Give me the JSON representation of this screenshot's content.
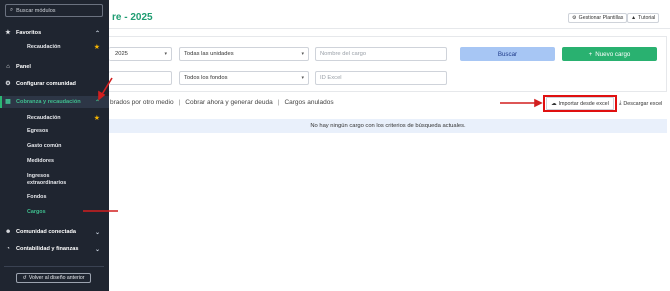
{
  "sidebar": {
    "search_placeholder": "Buscar módulos",
    "favoritos": "Favoritos",
    "fav_recaudacion": "Recaudación",
    "panel": "Panel",
    "configurar": "Configurar comunidad",
    "cobranza": "Cobranza y recaudación",
    "sub": [
      "Recaudación",
      "Egresos",
      "Gasto común",
      "Medidores",
      "Ingresos",
      "extraordinarios",
      "Fondos",
      "Cargos"
    ],
    "comunidad": "Comunidad conectada",
    "contabilidad": "Contabilidad y finanzas",
    "volver": "Volver al diseño anterior"
  },
  "header": {
    "title": "re - 2025",
    "gestionar": "Gestionar Plantillas",
    "tutorial": "Tutorial"
  },
  "filters": {
    "year": "2025",
    "unidades": "Todas las unidades",
    "nombre_cargo_placeholder": "Nombre del cargo",
    "fondos": "Todos los fondos",
    "id_excel_placeholder": "ID Excel",
    "buscar": "Buscar",
    "nuevo": "Nuevo cargo"
  },
  "tabs": {
    "t1": "brados por otro medio",
    "sep": "|",
    "t2": "Cobrar ahora y generar deuda",
    "t3": "Cargos anulados"
  },
  "actions": {
    "importar": "Importar desde excel",
    "descargar": "Descargar excel"
  },
  "notice": "No hay ningún cargo con los criterios de búsqueda actuales.",
  "colors": {
    "sidebar_bg": "#1f2530",
    "accent_green": "#29b170",
    "title_teal": "#1f9d72",
    "annotation_red": "#d21f1f"
  }
}
